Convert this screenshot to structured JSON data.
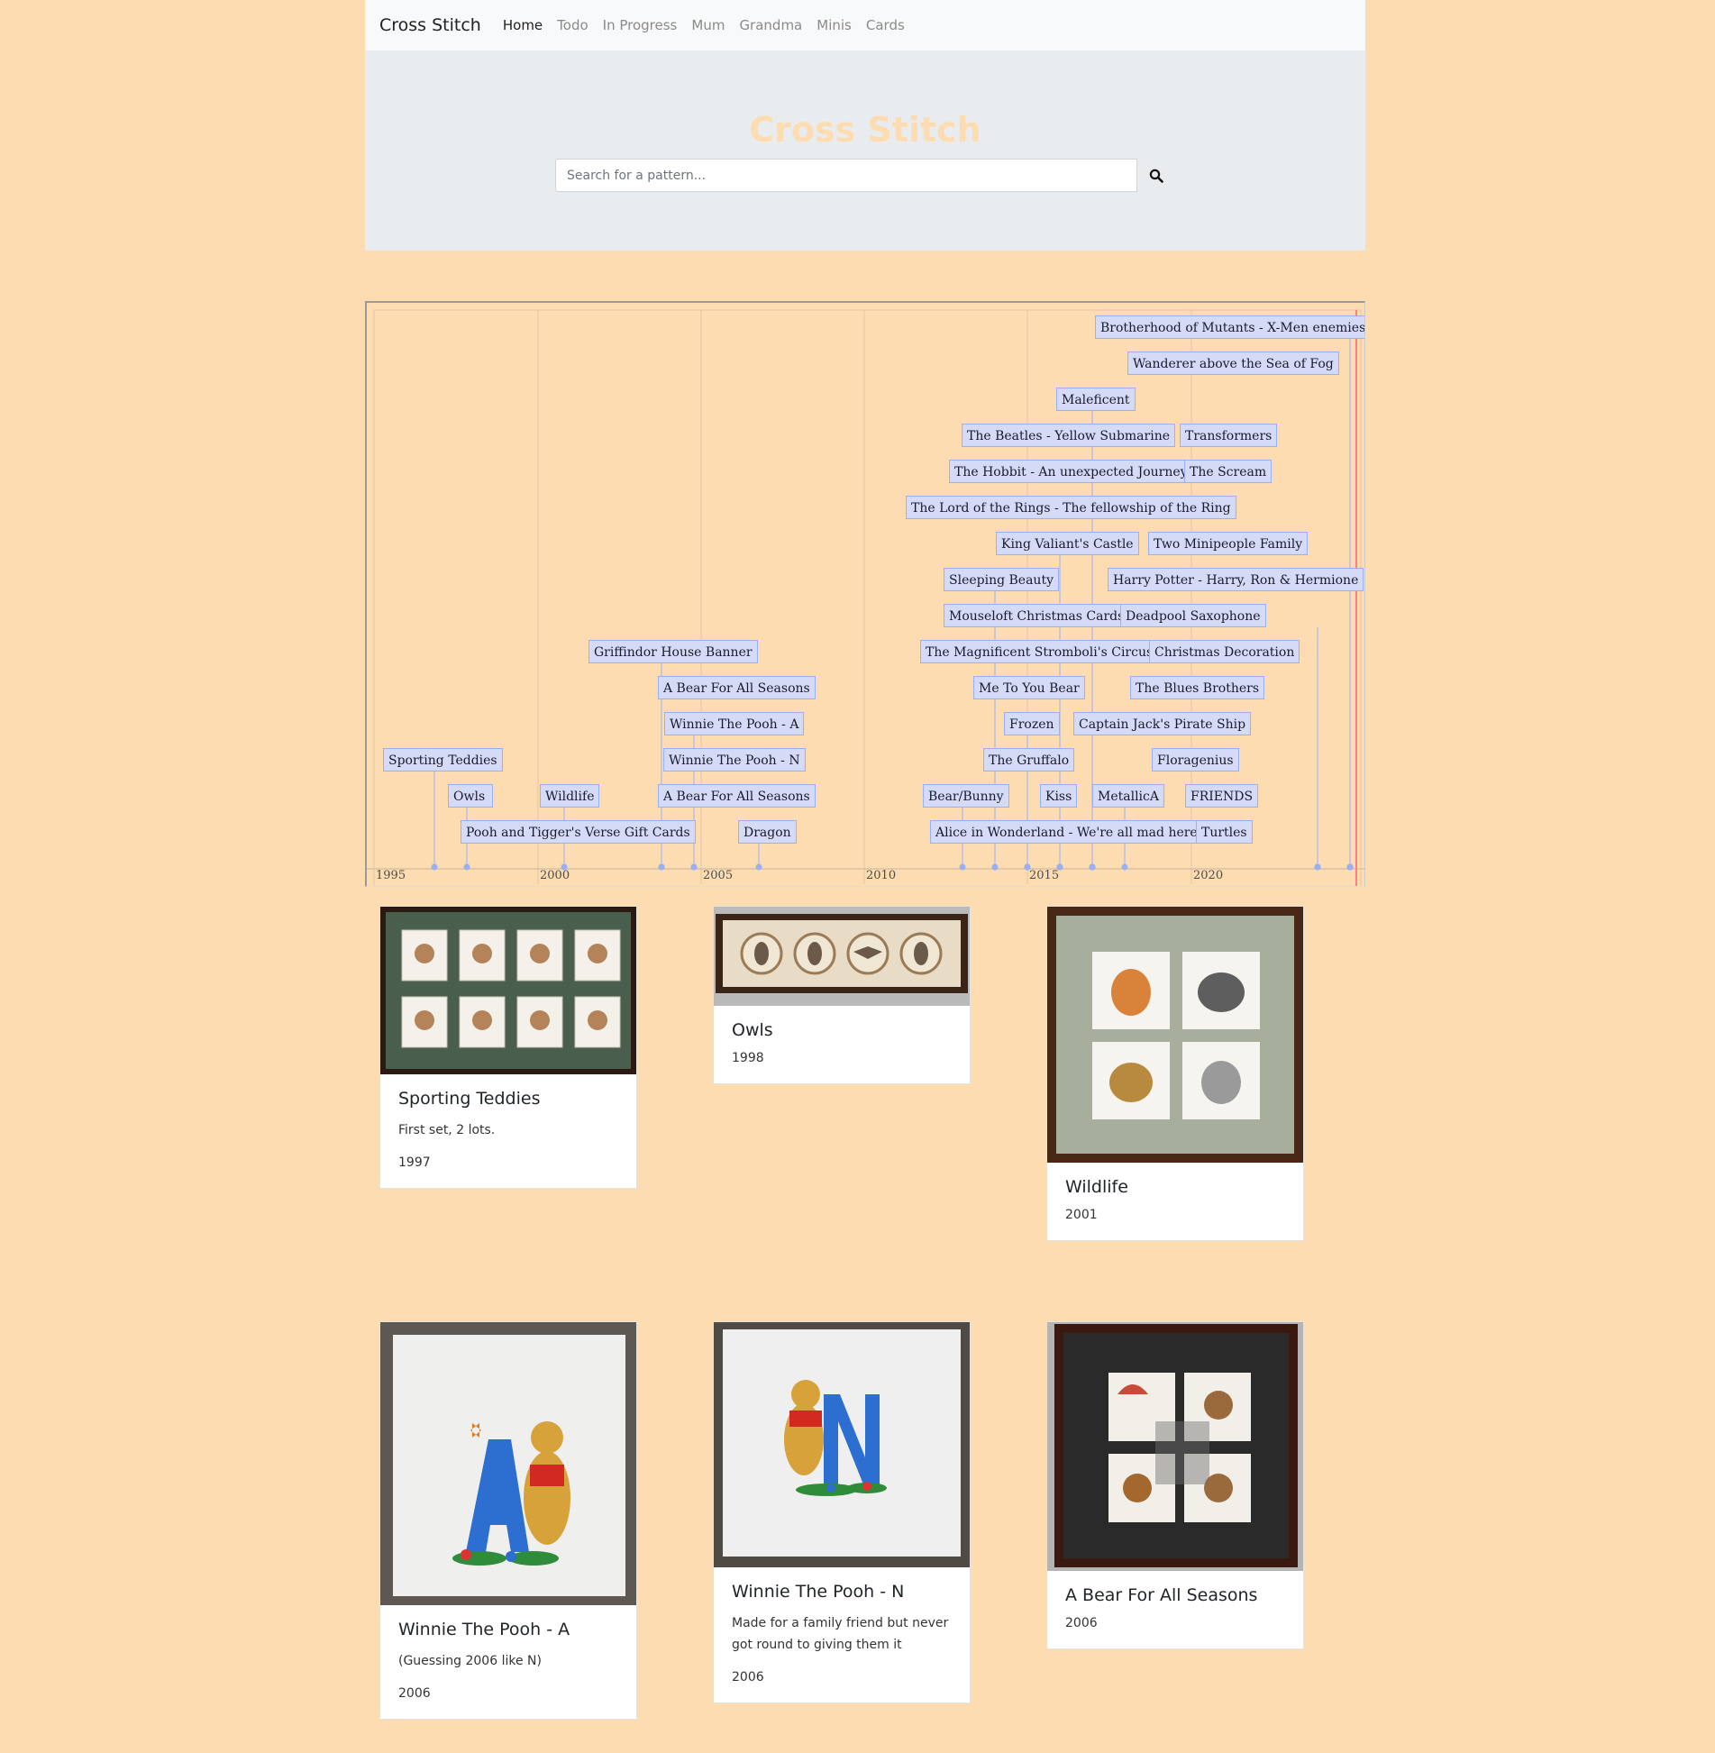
{
  "nav": {
    "brand": "Cross Stitch",
    "links": [
      "Home",
      "Todo",
      "In Progress",
      "Mum",
      "Grandma",
      "Minis",
      "Cards"
    ]
  },
  "hero": {
    "title": "Cross Stitch",
    "search_placeholder": "Search for a pattern..."
  },
  "timeline": {
    "axis_years": [
      "1995",
      "2000",
      "2005",
      "2010",
      "2015",
      "2020"
    ],
    "items": [
      "Brotherhood of Mutants - X-Men enemies",
      "Wanderer above the Sea of Fog",
      "Maleficent",
      "The Beatles - Yellow Submarine",
      "Transformers",
      "The Hobbit - An unexpected Journey",
      "The Scream",
      "The Lord of the Rings - The fellowship of the Ring",
      "King Valiant's Castle",
      "Two Minipeople Family",
      "Sleeping Beauty",
      "Harry Potter - Harry, Ron & Hermione",
      "Mouseloft Christmas Cards",
      "Deadpool Saxophone",
      "Griffindor House Banner",
      "The Magnificent Stromboli's Circus",
      "Christmas Decoration",
      "A Bear For All Seasons",
      "Me To You Bear",
      "The Blues Brothers",
      "Winnie The Pooh - A",
      "Frozen",
      "Captain Jack's Pirate Ship",
      "Sporting Teddies",
      "Winnie The Pooh - N",
      "The Gruffalo",
      "Floragenius",
      "Owls",
      "Wildlife",
      "A Bear For All Seasons",
      "Bear/Bunny",
      "Kiss",
      "MetallicA",
      "FRIENDS",
      "Pooh and Tigger's Verse Gift Cards",
      "Dragon",
      "Alice in Wonderland - We're all mad here",
      "Turtles"
    ]
  },
  "cards": [
    {
      "title": "Sporting Teddies",
      "text": "First set, 2 lots.",
      "year": "1997"
    },
    {
      "title": "Owls",
      "text": "",
      "year": "1998"
    },
    {
      "title": "Wildlife",
      "text": "",
      "year": "2001"
    },
    {
      "title": "Winnie The Pooh - A",
      "text": "(Guessing 2006 like N)",
      "year": "2006"
    },
    {
      "title": "Winnie The Pooh - N",
      "text": "Made for a family friend but never got round to giving them it",
      "year": "2006"
    },
    {
      "title": "A Bear For All Seasons",
      "text": "",
      "year": "2006"
    }
  ],
  "colors": {
    "page_background": "#fcdcb0",
    "timeline_item_fill": "#d5dbf7",
    "timeline_item_border": "#97b0f8",
    "current_time_line": "#ff7f7f"
  }
}
